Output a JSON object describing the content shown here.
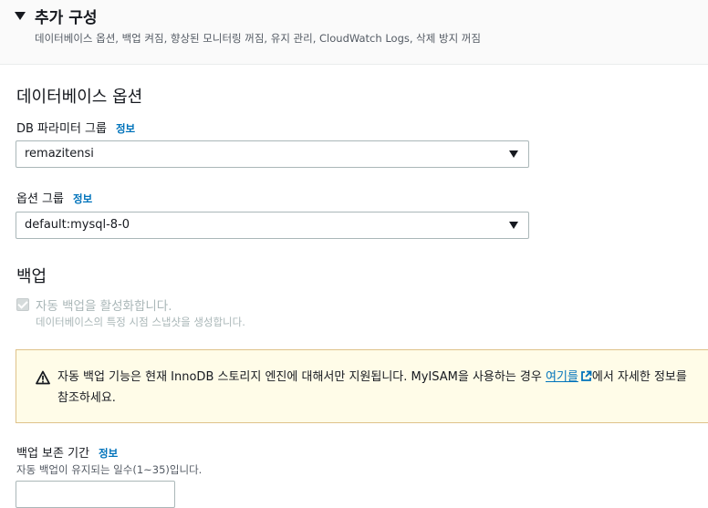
{
  "header": {
    "title": "추가 구성",
    "description": "데이터베이스 옵션, 백업 켜짐, 향상된 모니터링 꺼짐, 유지 관리, CloudWatch Logs, 삭제 방지 꺼짐"
  },
  "db_options": {
    "section_title": "데이터베이스 옵션",
    "param_group": {
      "label": "DB 파라미터 그룹",
      "info": "정보",
      "value": "remazitensi"
    },
    "option_group": {
      "label": "옵션 그룹",
      "info": "정보",
      "value": "default:mysql-8-0"
    }
  },
  "backup": {
    "section_title": "백업",
    "auto_backup": {
      "label": "자동 백업을 활성화합니다.",
      "description": "데이터베이스의 특정 시점 스냅샷을 생성합니다.",
      "checked": true,
      "disabled": true
    },
    "alert": {
      "text_before": "자동 백업 기능은 현재 InnoDB 스토리지 엔진에 대해서만 지원됩니다. MyISAM을 사용하는 경우 ",
      "link_text": "여기를",
      "text_after": "에서 자세한 정보를 참조하세요."
    },
    "retention": {
      "label": "백업 보존 기간",
      "info": "정보",
      "description": "자동 백업이 유지되는 일수(1~35)입니다."
    }
  },
  "colors": {
    "link": "#0073bb",
    "alert_bg": "#fffce8",
    "alert_border": "#dfc28a",
    "disabled_text": "#aab7b8"
  },
  "icons": {
    "caret": "caret-down-icon",
    "warning": "warning-icon",
    "external": "external-link-icon",
    "select_arrow": "dropdown-arrow-icon"
  }
}
